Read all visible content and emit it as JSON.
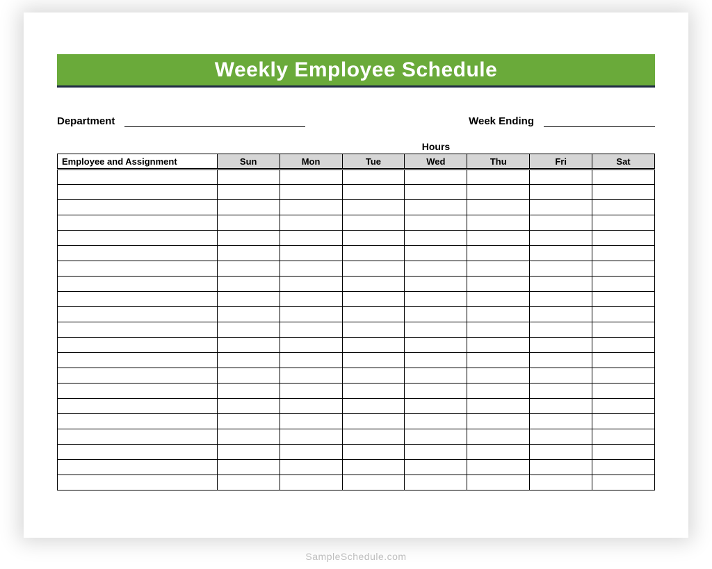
{
  "title": "Weekly Employee Schedule",
  "labels": {
    "department": "Department",
    "weekEnding": "Week Ending",
    "hours": "Hours",
    "employeeCol": "Employee and Assignment"
  },
  "fields": {
    "departmentValue": "",
    "weekEndingValue": ""
  },
  "days": [
    "Sun",
    "Mon",
    "Tue",
    "Wed",
    "Thu",
    "Fri",
    "Sat"
  ],
  "rows": [
    {
      "employee": "",
      "sun": "",
      "mon": "",
      "tue": "",
      "wed": "",
      "thu": "",
      "fri": "",
      "sat": ""
    },
    {
      "employee": "",
      "sun": "",
      "mon": "",
      "tue": "",
      "wed": "",
      "thu": "",
      "fri": "",
      "sat": ""
    },
    {
      "employee": "",
      "sun": "",
      "mon": "",
      "tue": "",
      "wed": "",
      "thu": "",
      "fri": "",
      "sat": ""
    },
    {
      "employee": "",
      "sun": "",
      "mon": "",
      "tue": "",
      "wed": "",
      "thu": "",
      "fri": "",
      "sat": ""
    },
    {
      "employee": "",
      "sun": "",
      "mon": "",
      "tue": "",
      "wed": "",
      "thu": "",
      "fri": "",
      "sat": ""
    },
    {
      "employee": "",
      "sun": "",
      "mon": "",
      "tue": "",
      "wed": "",
      "thu": "",
      "fri": "",
      "sat": ""
    },
    {
      "employee": "",
      "sun": "",
      "mon": "",
      "tue": "",
      "wed": "",
      "thu": "",
      "fri": "",
      "sat": ""
    },
    {
      "employee": "",
      "sun": "",
      "mon": "",
      "tue": "",
      "wed": "",
      "thu": "",
      "fri": "",
      "sat": ""
    },
    {
      "employee": "",
      "sun": "",
      "mon": "",
      "tue": "",
      "wed": "",
      "thu": "",
      "fri": "",
      "sat": ""
    },
    {
      "employee": "",
      "sun": "",
      "mon": "",
      "tue": "",
      "wed": "",
      "thu": "",
      "fri": "",
      "sat": ""
    },
    {
      "employee": "",
      "sun": "",
      "mon": "",
      "tue": "",
      "wed": "",
      "thu": "",
      "fri": "",
      "sat": ""
    },
    {
      "employee": "",
      "sun": "",
      "mon": "",
      "tue": "",
      "wed": "",
      "thu": "",
      "fri": "",
      "sat": ""
    },
    {
      "employee": "",
      "sun": "",
      "mon": "",
      "tue": "",
      "wed": "",
      "thu": "",
      "fri": "",
      "sat": ""
    },
    {
      "employee": "",
      "sun": "",
      "mon": "",
      "tue": "",
      "wed": "",
      "thu": "",
      "fri": "",
      "sat": ""
    },
    {
      "employee": "",
      "sun": "",
      "mon": "",
      "tue": "",
      "wed": "",
      "thu": "",
      "fri": "",
      "sat": ""
    },
    {
      "employee": "",
      "sun": "",
      "mon": "",
      "tue": "",
      "wed": "",
      "thu": "",
      "fri": "",
      "sat": ""
    },
    {
      "employee": "",
      "sun": "",
      "mon": "",
      "tue": "",
      "wed": "",
      "thu": "",
      "fri": "",
      "sat": ""
    },
    {
      "employee": "",
      "sun": "",
      "mon": "",
      "tue": "",
      "wed": "",
      "thu": "",
      "fri": "",
      "sat": ""
    },
    {
      "employee": "",
      "sun": "",
      "mon": "",
      "tue": "",
      "wed": "",
      "thu": "",
      "fri": "",
      "sat": ""
    },
    {
      "employee": "",
      "sun": "",
      "mon": "",
      "tue": "",
      "wed": "",
      "thu": "",
      "fri": "",
      "sat": ""
    },
    {
      "employee": "",
      "sun": "",
      "mon": "",
      "tue": "",
      "wed": "",
      "thu": "",
      "fri": "",
      "sat": ""
    }
  ],
  "watermark": "SampleSchedule.com",
  "colors": {
    "bandGreen": "#6aaa3a",
    "bandUnderline": "#1f2a44",
    "headerGrey": "#d6d6d6"
  }
}
